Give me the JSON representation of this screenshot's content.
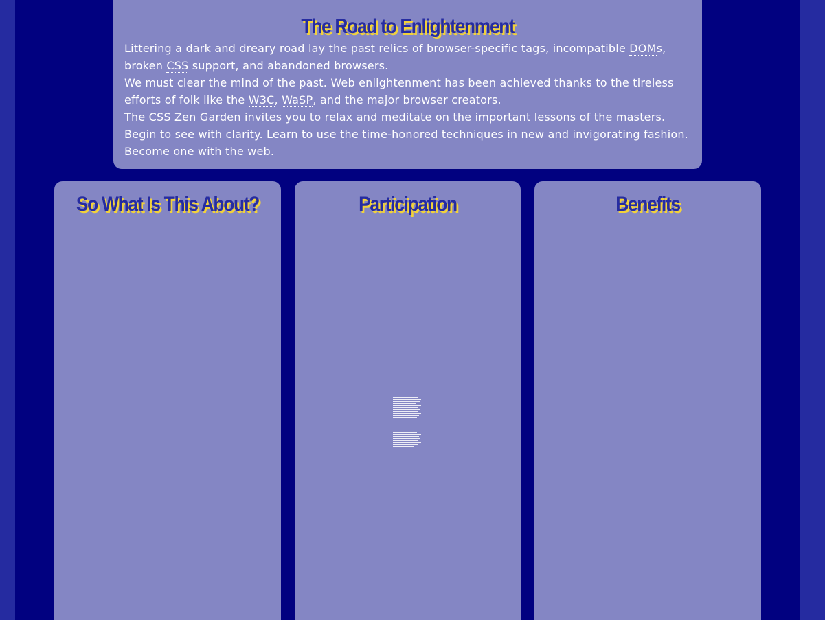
{
  "intro": {
    "heading": "The Road to Enlightenment",
    "p1_part1": "Littering a dark and dreary road lay the past relics of browser-specific tags, incompatible ",
    "p1_abbr_dom": "DOM",
    "p1_part2": "s, broken ",
    "p1_abbr_css": "CSS",
    "p1_part3": " support, and abandoned browsers.",
    "p2_part1": "We must clear the mind of the past. Web enlightenment has been achieved thanks to the tireless efforts of folk like the ",
    "p2_abbr_w3c": "W3C",
    "p2_sep": ", ",
    "p2_abbr_wasp": "WaSP",
    "p2_part2": ", and the major browser creators.",
    "p3": "The CSS Zen Garden invites you to relax and meditate on the important lessons of the masters. Begin to see with clarity. Learn to use the time-honored techniques in new and invigorating fashion. Become one with the web."
  },
  "columns": [
    {
      "heading": "So What Is This About?"
    },
    {
      "heading": "Participation"
    },
    {
      "heading": "Benefits"
    }
  ],
  "colors": {
    "outer_background": "#252ba0",
    "page_background": "#010180",
    "panel": "#8486c4",
    "heading_text": "#262ca1",
    "heading_shadow": "#f2d23a",
    "body_text": "#ffffff"
  }
}
